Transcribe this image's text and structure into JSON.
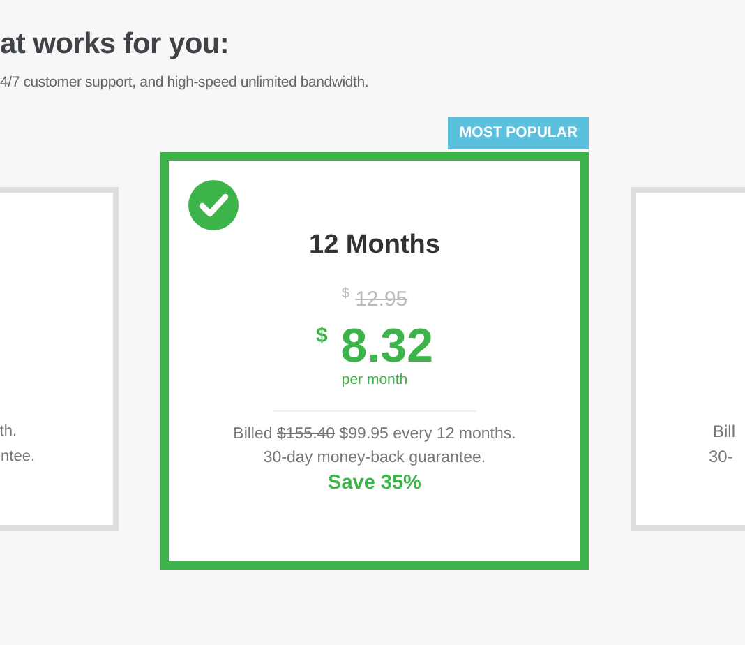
{
  "heading": "at works for you:",
  "subtitle": "4/7 customer support, and high-speed unlimited bandwidth.",
  "badge": "MOST POPULAR",
  "plans": [
    {
      "selected": false,
      "lines": [
        "th.",
        "ntee."
      ]
    },
    {
      "selected": true,
      "title": "12 Months",
      "old_currency": "$",
      "old_price": "12.95",
      "currency": "$",
      "price": "8.32",
      "period": "per month",
      "billed_prefix": "Billed",
      "billed_old": "$155.40",
      "billed_rest": "$99.95 every 12 months.",
      "guarantee": "30-day money-back guarantee.",
      "save": "Save 35%"
    },
    {
      "selected": false,
      "lines": [
        "Bill",
        "30-"
      ]
    }
  ]
}
